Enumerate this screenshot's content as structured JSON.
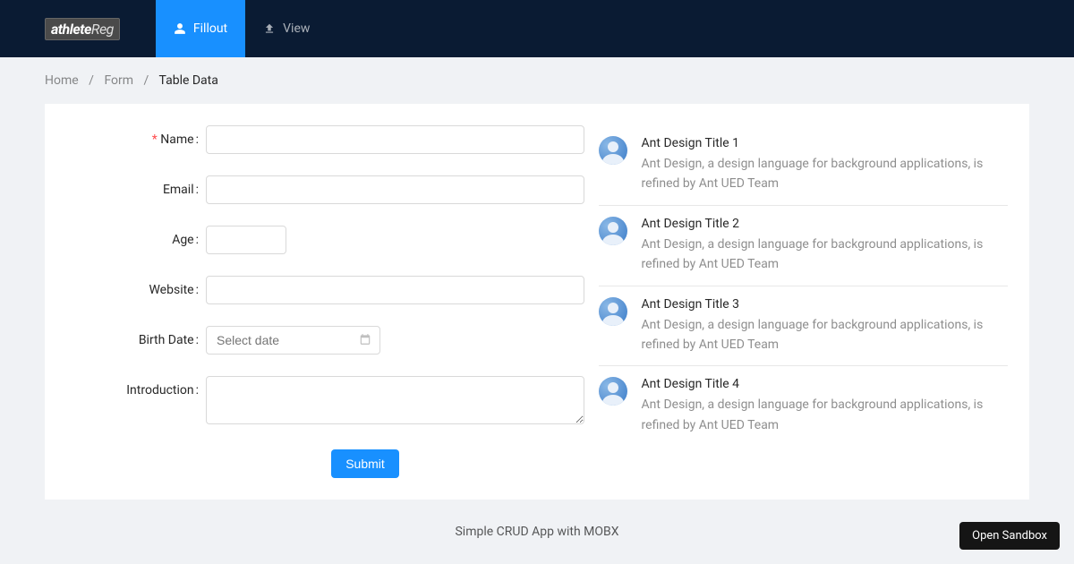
{
  "brand": {
    "name1": "athlete",
    "name2": "Reg"
  },
  "nav": {
    "items": [
      {
        "label": "Fillout",
        "icon": "user"
      },
      {
        "label": "View",
        "icon": "upload"
      }
    ]
  },
  "breadcrumb": {
    "items": [
      "Home",
      "Form",
      "Table Data"
    ]
  },
  "form": {
    "labels": {
      "name": "Name",
      "email": "Email",
      "age": "Age",
      "website": "Website",
      "birth": "Birth Date",
      "intro": "Introduction"
    },
    "date_placeholder": "Select date",
    "submit": "Submit"
  },
  "list": {
    "items": [
      {
        "title": "Ant Design Title 1",
        "desc": "Ant Design, a design language for background applications, is refined by Ant UED Team"
      },
      {
        "title": "Ant Design Title 2",
        "desc": "Ant Design, a design language for background applications, is refined by Ant UED Team"
      },
      {
        "title": "Ant Design Title 3",
        "desc": "Ant Design, a design language for background applications, is refined by Ant UED Team"
      },
      {
        "title": "Ant Design Title 4",
        "desc": "Ant Design, a design language for background applications, is refined by Ant UED Team"
      }
    ]
  },
  "footer": {
    "text": "Simple CRUD App with MOBX"
  },
  "sandbox": {
    "label": "Open Sandbox"
  }
}
